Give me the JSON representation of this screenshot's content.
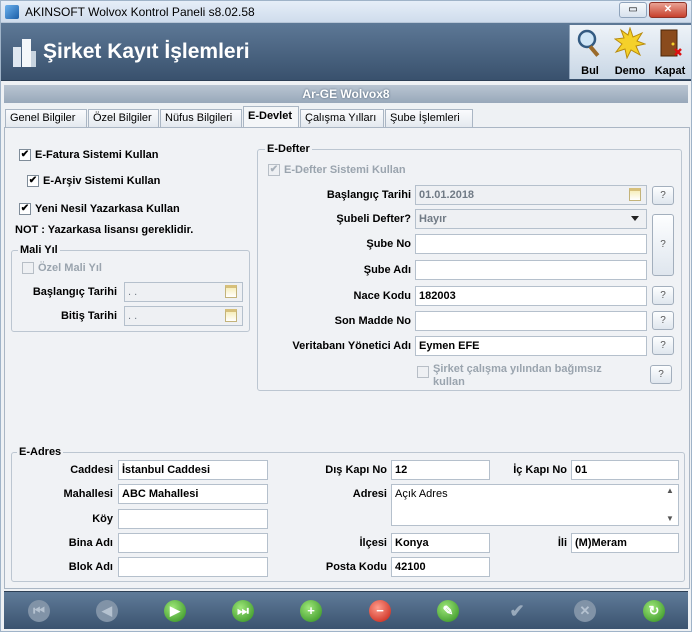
{
  "window": {
    "title": "AKINSOFT Wolvox Kontrol Paneli s8.02.58",
    "minimize": "▭",
    "maximize": "▭",
    "close": "✕"
  },
  "header": {
    "title": "Şirket Kayıt İşlemleri",
    "buttons": [
      "Bul",
      "Demo",
      "Kapat"
    ]
  },
  "subheader": "Ar-GE Wolvox8",
  "tabs": [
    "Genel Bilgiler",
    "Özel Bilgiler",
    "Nüfus Bilgileri",
    "E-Devlet",
    "Çalışma Yılları",
    "Şube İşlemleri"
  ],
  "active_tab": "E-Devlet",
  "left": {
    "efatura": {
      "label": "E-Fatura Sistemi Kullan",
      "checked": true
    },
    "earsiv": {
      "label": "E-Arşiv Sistemi Kullan",
      "checked": true
    },
    "yazarkasa": {
      "label": "Yeni Nesil Yazarkasa Kullan",
      "checked": true
    },
    "note": "NOT : Yazarkasa lisansı gereklidir.",
    "mali_yil": {
      "title": "Mali Yıl",
      "ozel_label": "Özel Mali Yıl",
      "baslangic_label": "Başlangıç Tarihi",
      "baslangic_value": ". .",
      "bitis_label": "Bitiş Tarihi",
      "bitis_value": ". ."
    }
  },
  "edefter": {
    "title": "E-Defter",
    "use_label": "E-Defter Sistemi Kullan",
    "baslangic_label": "Başlangıç Tarihi",
    "baslangic_value": "01.01.2018",
    "subeli_label": "Şubeli Defter?",
    "subeli_value": "Hayır",
    "sube_no_label": "Şube No",
    "sube_no_value": "",
    "sube_adi_label": "Şube Adı",
    "sube_adi_value": "",
    "nace_label": "Nace Kodu",
    "nace_value": "182003",
    "son_madde_label": "Son Madde No",
    "son_madde_value": "",
    "yonetici_label": "Veritabanı Yönetici Adı",
    "yonetici_value": "Eymen EFE",
    "bagimsiz_label1": "Şirket çalışma yılından bağımsız",
    "bagimsiz_label2": "kullan",
    "help": "?"
  },
  "eadres": {
    "title": "E-Adres",
    "caddesi_label": "Caddesi",
    "caddesi_value": "İstanbul Caddesi",
    "mahallesi_label": "Mahallesi",
    "mahallesi_value": "ABC Mahallesi",
    "koy_label": "Köy",
    "koy_value": "",
    "bina_label": "Bina Adı",
    "bina_value": "",
    "blok_label": "Blok Adı",
    "blok_value": "",
    "dis_kapi_label": "Dış Kapı No",
    "dis_kapi_value": "12",
    "ic_kapi_label": "İç Kapı No",
    "ic_kapi_value": "01",
    "adres_label": "Adresi",
    "adres_value": "Açık Adres",
    "ilce_label": "İlçesi",
    "ilce_value": "Konya",
    "il_label": "İli",
    "il_value": "(M)Meram",
    "posta_label": "Posta Kodu",
    "posta_value": "42100"
  },
  "navbar": {
    "icons": [
      "first-icon",
      "prev-icon",
      "next-icon",
      "last-icon",
      "add-icon",
      "delete-icon",
      "edit-icon",
      "confirm-icon",
      "cancel-icon",
      "refresh-icon"
    ]
  }
}
